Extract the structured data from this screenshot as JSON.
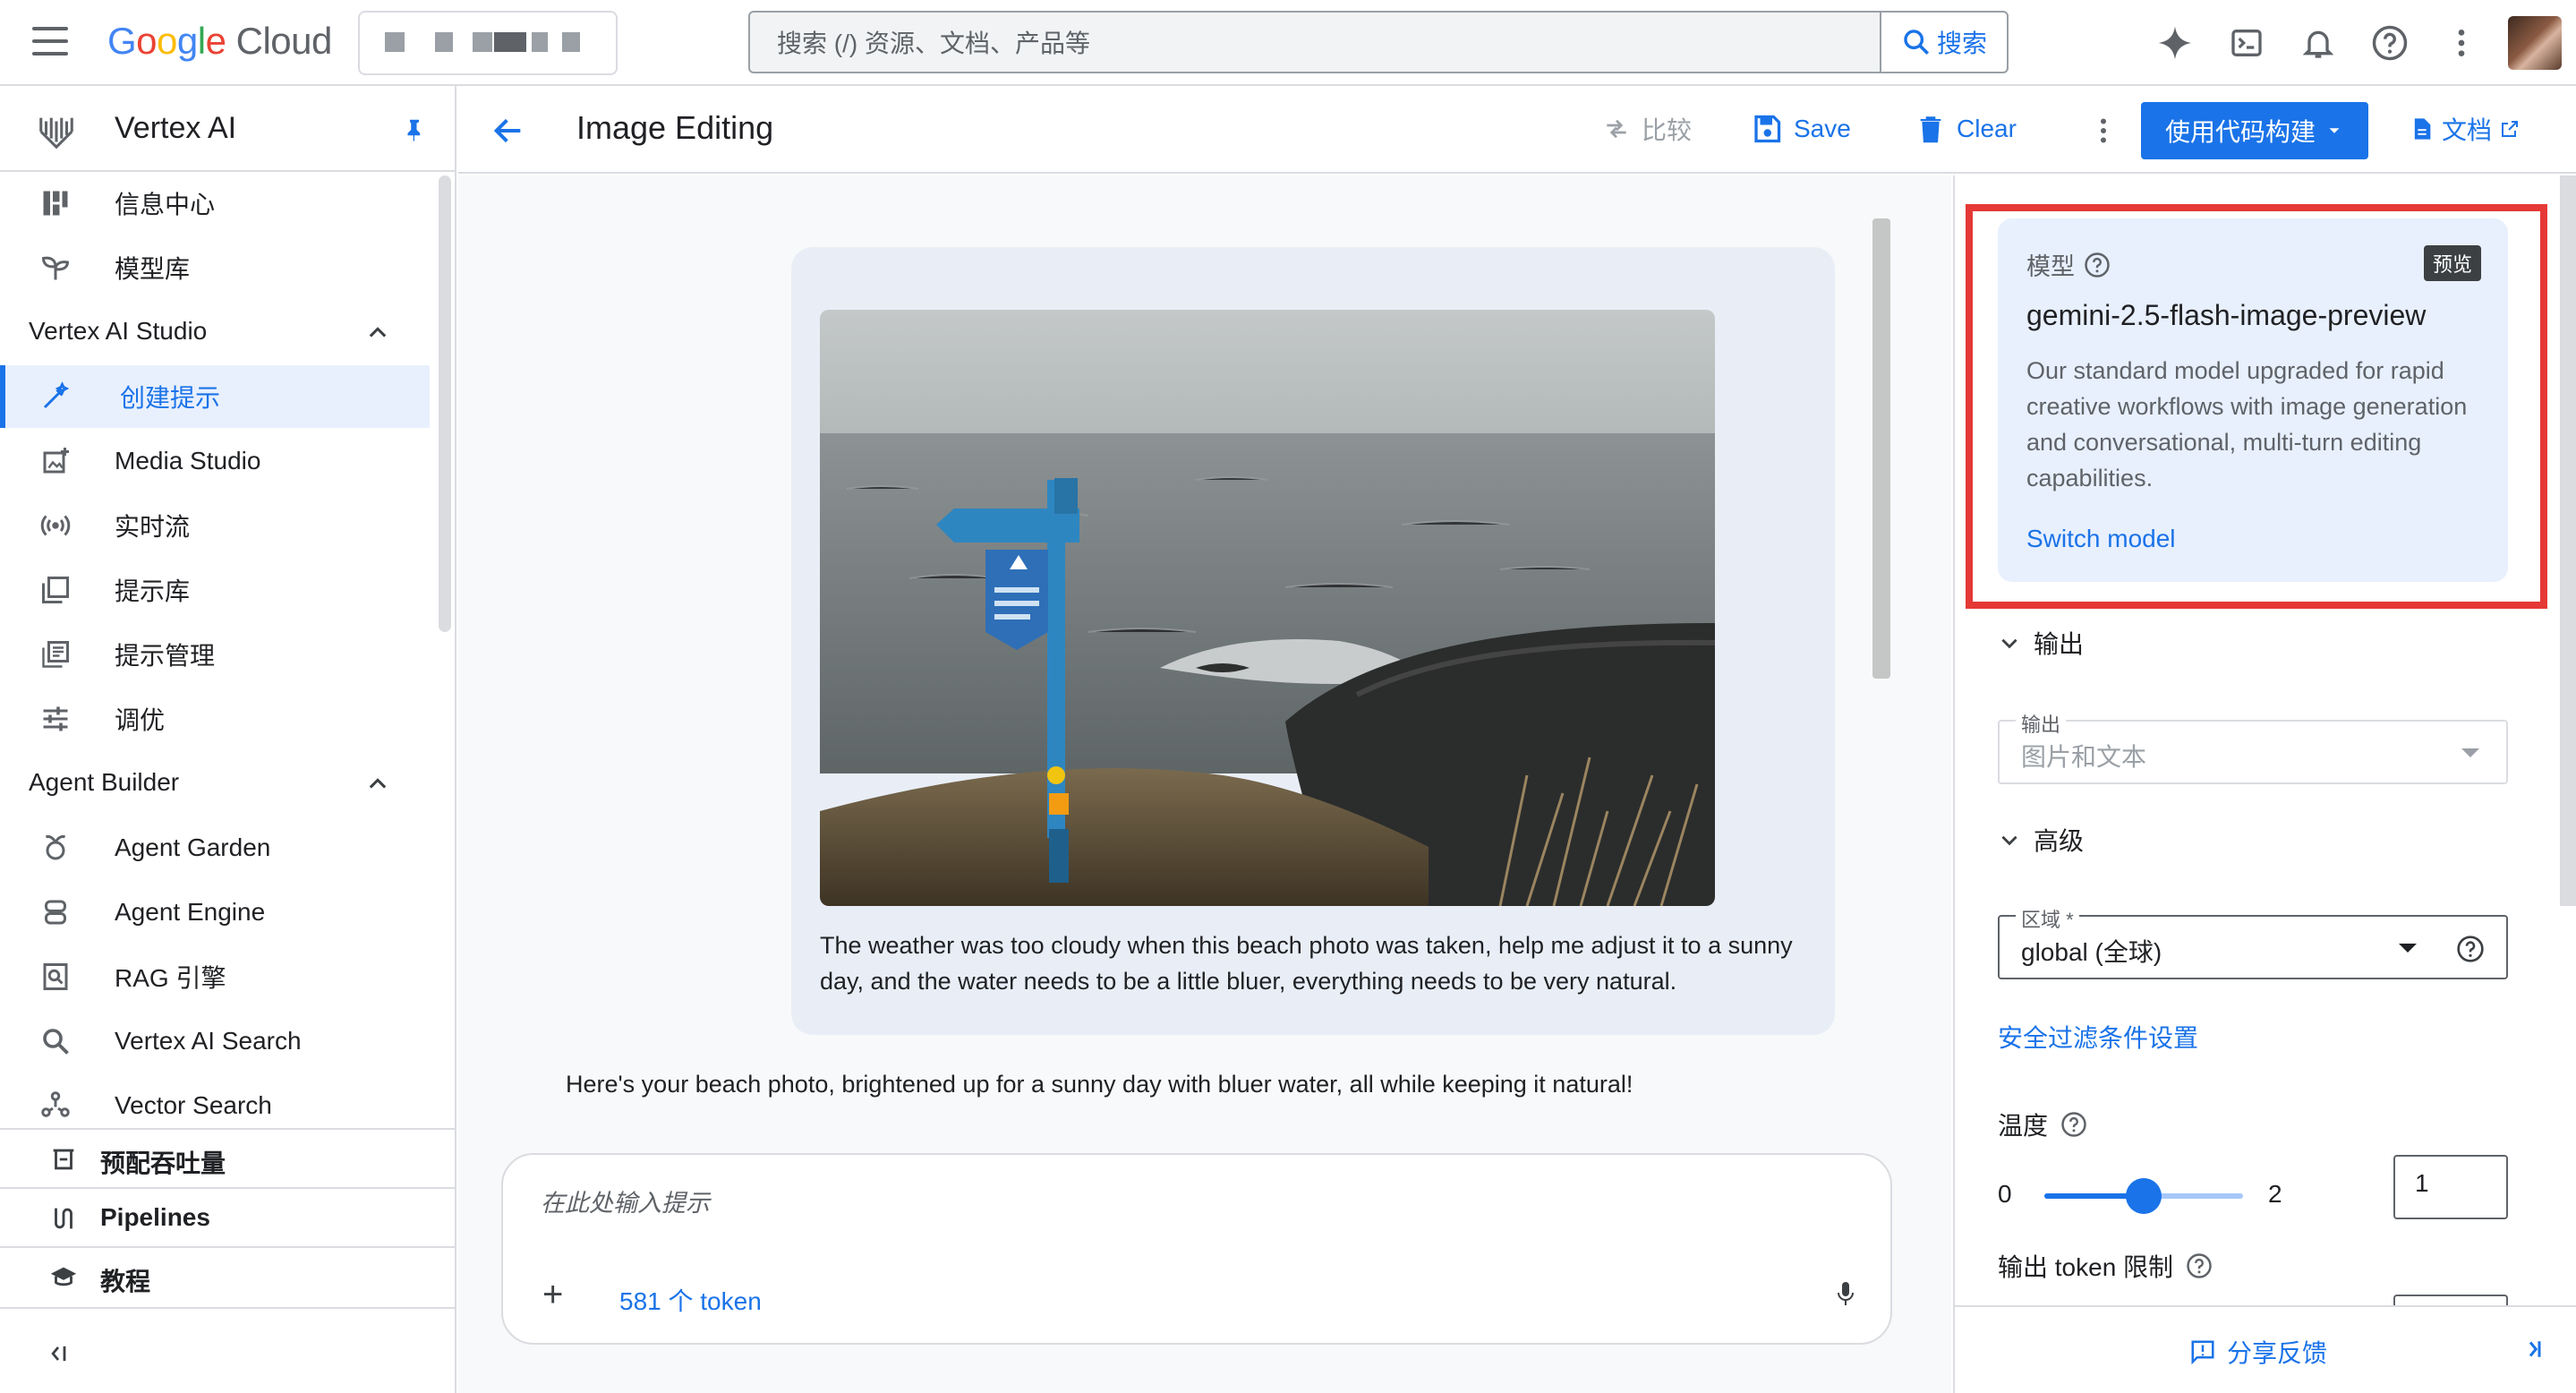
{
  "topbar": {
    "logo_google": "Google",
    "logo_cloud": "Cloud",
    "search_placeholder": "搜索 (/) 资源、文档、产品等",
    "search_button": "搜索",
    "icons": [
      "gemini-spark-icon",
      "cloud-shell-icon",
      "notifications-icon",
      "help-icon",
      "more-vert-icon"
    ]
  },
  "sidebar": {
    "product_title": "Vertex AI",
    "items_top": [
      {
        "label": "信息中心",
        "icon": "dashboard-icon"
      },
      {
        "label": "模型库",
        "icon": "model-garden-icon"
      }
    ],
    "sections": [
      {
        "title": "Vertex AI Studio",
        "items": [
          {
            "label": "创建提示",
            "icon": "create-prompt-icon",
            "active": true
          },
          {
            "label": "Media Studio",
            "icon": "media-studio-icon"
          },
          {
            "label": "实时流",
            "icon": "stream-icon"
          },
          {
            "label": "提示库",
            "icon": "prompt-gallery-icon"
          },
          {
            "label": "提示管理",
            "icon": "prompt-management-icon"
          },
          {
            "label": "调优",
            "icon": "tune-icon"
          }
        ]
      },
      {
        "title": "Agent Builder",
        "items": [
          {
            "label": "Agent Garden",
            "icon": "agent-garden-icon"
          },
          {
            "label": "Agent Engine",
            "icon": "agent-engine-icon"
          },
          {
            "label": "RAG 引擎",
            "icon": "rag-engine-icon"
          },
          {
            "label": "Vertex AI Search",
            "icon": "search-icon"
          },
          {
            "label": "Vector Search",
            "icon": "vector-search-icon"
          }
        ]
      }
    ],
    "pinned": [
      {
        "label": "预配吞吐量",
        "icon": "throughput-icon"
      },
      {
        "label": "Pipelines",
        "icon": "pipelines-icon"
      },
      {
        "label": "教程",
        "icon": "tutorial-icon"
      }
    ]
  },
  "header": {
    "title": "Image Editing",
    "compare_label": "比较",
    "save_label": "Save",
    "clear_label": "Clear",
    "build_with_code_label": "使用代码构建",
    "docs_label": "文档"
  },
  "chat": {
    "user_message": "The weather was too cloudy when this beach photo was taken, help me adjust it to a sunny day, and the water needs to be a little bluer, everything needs to be very natural.",
    "model_reply": "Here's your beach photo, brightened up for a sunny day with bluer water, all while keeping it natural!",
    "prompt_placeholder": "在此处输入提示",
    "token_count": "581 个 token"
  },
  "right_panel": {
    "model_label": "模型",
    "preview_badge": "预览",
    "model_name": "gemini-2.5-flash-image-preview",
    "model_description": "Our standard model upgraded for rapid creative workflows with image generation and conversational, multi-turn editing capabilities.",
    "switch_model": "Switch model",
    "output_section": "输出",
    "output_field_label": "输出",
    "output_field_value": "图片和文本",
    "advanced_section": "高级",
    "region_label": "区域 *",
    "region_value": "global (全球)",
    "safety_link": "安全过滤条件设置",
    "temperature_label": "温度",
    "temperature_min": "0",
    "temperature_max": "2",
    "temperature_value": "1",
    "temperature_fraction": 0.5,
    "output_token_label": "输出 token 限制",
    "feedback_label": "分享反馈"
  },
  "colors": {
    "accent": "#1a73e8",
    "highlight_box": "#e53935",
    "model_card_bg": "#e8f0fe"
  }
}
